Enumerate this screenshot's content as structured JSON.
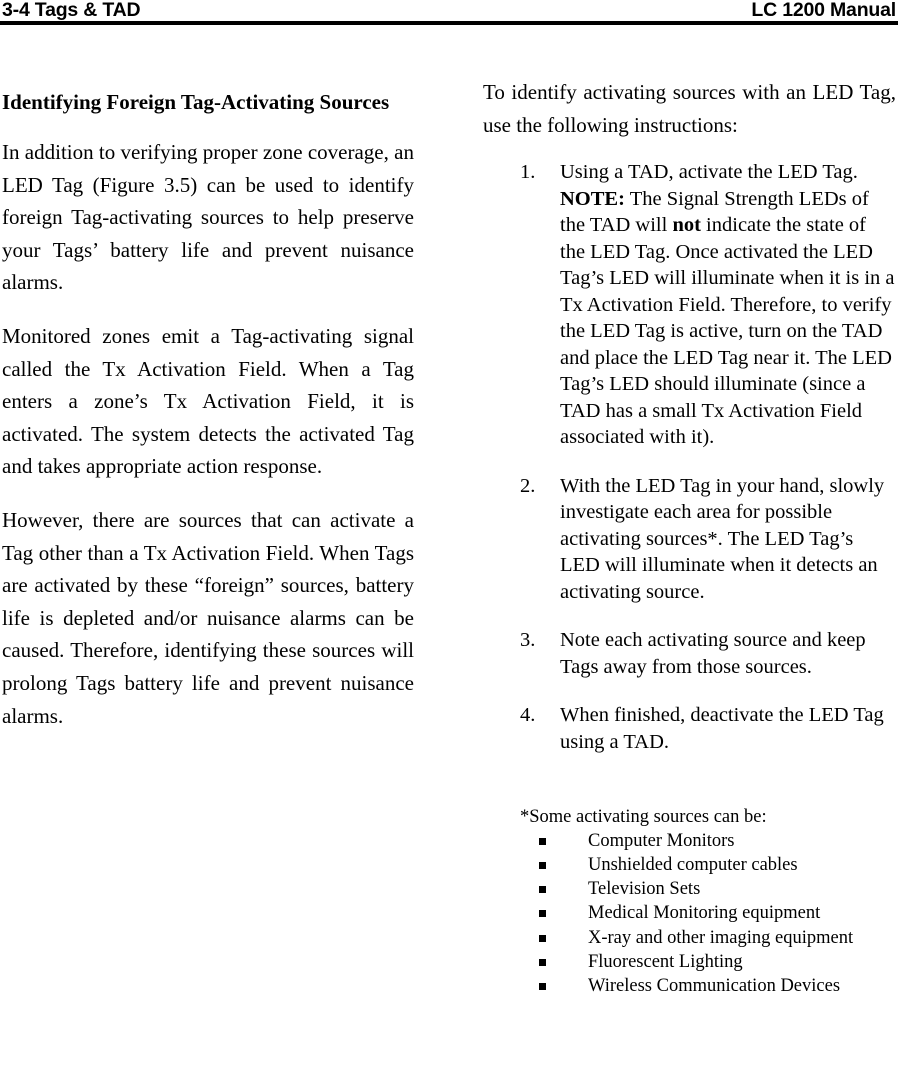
{
  "header": {
    "left": "3-4 Tags & TAD",
    "right": "LC 1200 Manual"
  },
  "left_column": {
    "heading": "Identifying Foreign Tag-Activating Sources",
    "paragraphs": [
      "In addition to verifying proper zone coverage, an LED Tag (Figure 3.5) can be used to identify foreign Tag-activating sources to help preserve your Tags’ battery life and prevent nuisance alarms.",
      "Monitored zones emit a Tag-activating signal called the Tx Activation Field. When a Tag enters a zone’s Tx Activation Field, it is activated. The system detects the activated Tag and takes appropriate action response.",
      "However, there are sources that can activate a Tag other than a Tx Activation Field. When Tags are activated by these “foreign” sources, battery life is depleted and/or nuisance alarms can be caused.  Therefore, identifying these sources will prolong Tags battery life and prevent nuisance alarms."
    ]
  },
  "right_column": {
    "intro": "To identify activating sources with an LED Tag, use the following instructions:",
    "steps": [
      {
        "number": "1.",
        "parts": [
          {
            "text": "Using a TAD, activate the LED Tag. ",
            "bold": false
          },
          {
            "text": "NOTE:",
            "bold": true
          },
          {
            "text": " The Signal Strength LEDs of the TAD will ",
            "bold": false
          },
          {
            "text": "not",
            "bold": true
          },
          {
            "text": " indicate the state of the LED Tag. Once activated the LED Tag’s LED will illuminate when it is in a Tx Activation Field. Therefore, to verify the LED Tag is active, turn on the TAD and place the LED Tag near it. The LED Tag’s LED should illuminate (since a TAD has a small Tx Activation Field associated with it).",
            "bold": false
          }
        ]
      },
      {
        "number": "2.",
        "parts": [
          {
            "text": "With the LED Tag in your hand, slowly investigate each area for possible activating sources*. The LED Tag’s LED will illuminate when it detects an activating source.",
            "bold": false
          }
        ]
      },
      {
        "number": "3.",
        "parts": [
          {
            "text": "Note each activating source and keep Tags away from those sources.",
            "bold": false
          }
        ]
      },
      {
        "number": "4.",
        "parts": [
          {
            "text": "When finished, deactivate the LED Tag using a TAD.",
            "bold": false
          }
        ]
      }
    ],
    "footnote": {
      "lead": "*Some activating sources can be:",
      "bullet_icon": "square-bullet-icon",
      "items": [
        "Computer Monitors",
        "Unshielded computer cables",
        "Television Sets",
        "Medical Monitoring equipment",
        "X-ray and other imaging equipment",
        "Fluorescent Lighting",
        "Wireless Communication Devices"
      ]
    }
  }
}
